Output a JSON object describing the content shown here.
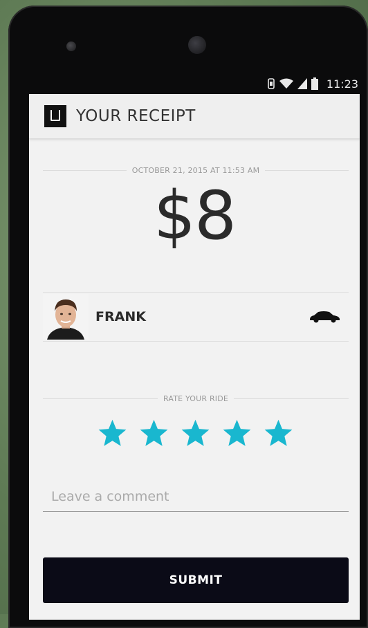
{
  "status_bar": {
    "time": "11:23",
    "icons": [
      "vibrate-icon",
      "wifi-icon",
      "cell-signal-icon",
      "battery-icon"
    ]
  },
  "app_bar": {
    "logo": "uber-logo",
    "title": "YOUR RECEIPT"
  },
  "receipt": {
    "datetime": "OCTOBER 21, 2015 AT 11:53 AM",
    "amount": "$8"
  },
  "driver": {
    "name": "FRANK",
    "vehicle_icon": "car-icon"
  },
  "rating": {
    "label": "RATE YOUR RIDE",
    "stars_filled": 5,
    "stars_total": 5,
    "star_color": "#19b7cf"
  },
  "comment": {
    "placeholder": "Leave a comment",
    "value": ""
  },
  "submit_label": "SUBMIT",
  "colors": {
    "button_bg": "#0b0b17",
    "screen_bg": "#f2f2f2"
  }
}
